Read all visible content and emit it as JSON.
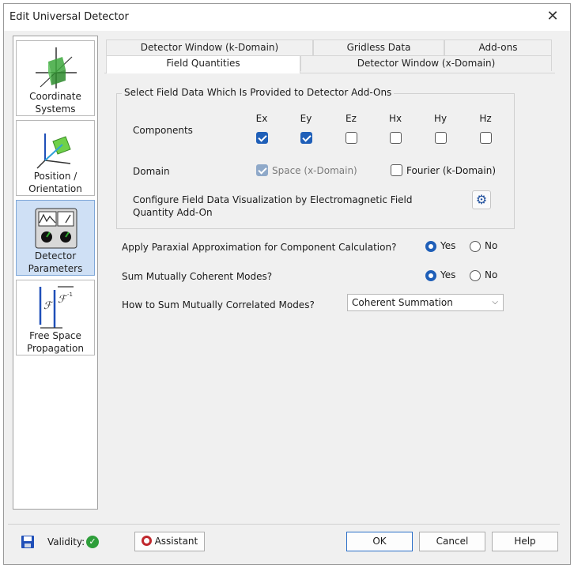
{
  "window": {
    "title": "Edit Universal Detector",
    "close_glyph": "✕"
  },
  "sidebar": {
    "items": [
      {
        "label1": "Coordinate",
        "label2": "Systems",
        "icon": "coordinate-systems-icon"
      },
      {
        "label1": "Position /",
        "label2": "Orientation",
        "icon": "position-orientation-icon"
      },
      {
        "label1": "Detector",
        "label2": "Parameters",
        "icon": "detector-parameters-icon",
        "active": true
      },
      {
        "label1": "Free Space",
        "label2": "Propagation",
        "icon": "free-space-propagation-icon"
      }
    ]
  },
  "tabs": {
    "row1": [
      "Detector Window (k-Domain)",
      "Gridless Data",
      "Add-ons"
    ],
    "row2": [
      "Field Quantities",
      "Detector Window (x-Domain)"
    ],
    "selected": "Field Quantities"
  },
  "field_group": {
    "title": "Select Field Data Which Is Provided to Detector Add-Ons",
    "components_label": "Components",
    "components": [
      {
        "name": "Ex",
        "checked": true
      },
      {
        "name": "Ey",
        "checked": true
      },
      {
        "name": "Ez",
        "checked": false
      },
      {
        "name": "Hx",
        "checked": false
      },
      {
        "name": "Hy",
        "checked": false
      },
      {
        "name": "Hz",
        "checked": false
      }
    ],
    "domain_label": "Domain",
    "domain_space": "Space (x-Domain)",
    "domain_fourier": "Fourier (k-Domain)",
    "configure_line1": "Configure Field Data Visualization by Electromagnetic Field",
    "configure_line2": "Quantity Add-On"
  },
  "paraxial": {
    "question": "Apply Paraxial Approximation for Component Calculation?",
    "yes": "Yes",
    "no": "No",
    "value": "Yes"
  },
  "coherent": {
    "question": "Sum Mutually Coherent Modes?",
    "yes": "Yes",
    "no": "No",
    "value": "Yes"
  },
  "correlated": {
    "question": "How to Sum Mutually Correlated Modes?",
    "selected": "Coherent Summation"
  },
  "footer": {
    "validity_label": "Validity:",
    "assistant_label": "Assistant",
    "ok_label": "OK",
    "cancel_label": "Cancel",
    "help_label": "Help"
  },
  "colors": {
    "accent": "#1f5fb8",
    "active_sidebar": "#cfe0f5",
    "valid": "#2e9e3a"
  }
}
